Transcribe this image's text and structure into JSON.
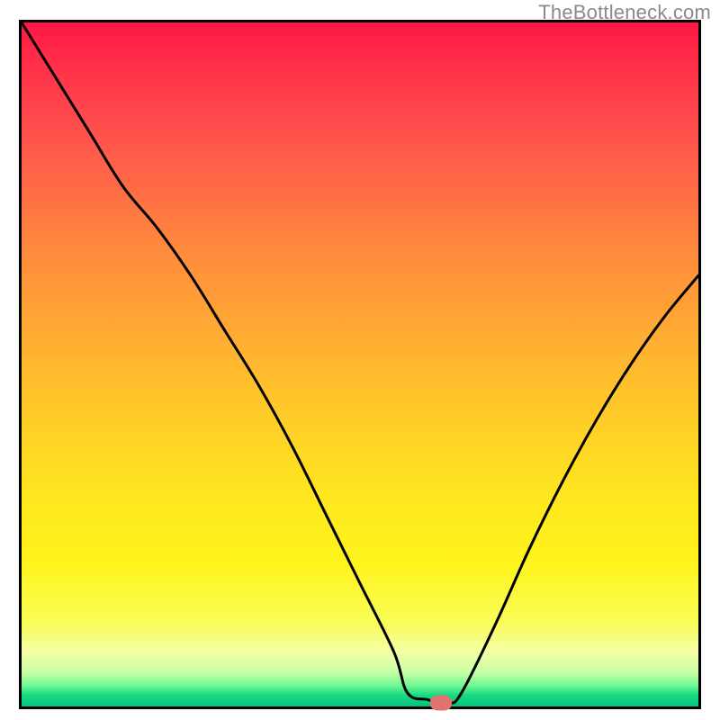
{
  "watermark": "TheBottleneck.com",
  "chart_data": {
    "type": "line",
    "title": "",
    "xlabel": "",
    "ylabel": "",
    "xlim": [
      0,
      100
    ],
    "ylim": [
      0,
      100
    ],
    "grid": false,
    "legend": false,
    "background_gradient": {
      "top_color": "#ff1744",
      "bottom_color": "#00c47e",
      "description": "vertical gradient red (top) → orange → yellow → green (bottom)"
    },
    "series": [
      {
        "name": "bottleneck-curve",
        "color": "#000000",
        "x": [
          0,
          5,
          10,
          15,
          20,
          25,
          30,
          35,
          40,
          45,
          50,
          55,
          57,
          60,
          63,
          65,
          70,
          75,
          80,
          85,
          90,
          95,
          100
        ],
        "y": [
          100,
          92,
          84,
          76,
          70,
          63,
          55,
          47,
          38,
          28,
          18,
          8,
          2,
          1,
          0.5,
          2,
          12,
          23,
          33,
          42,
          50,
          57,
          63
        ]
      }
    ],
    "marker": {
      "name": "optimal-point",
      "x": 62,
      "y": 0.5,
      "color": "#e0736e"
    }
  }
}
